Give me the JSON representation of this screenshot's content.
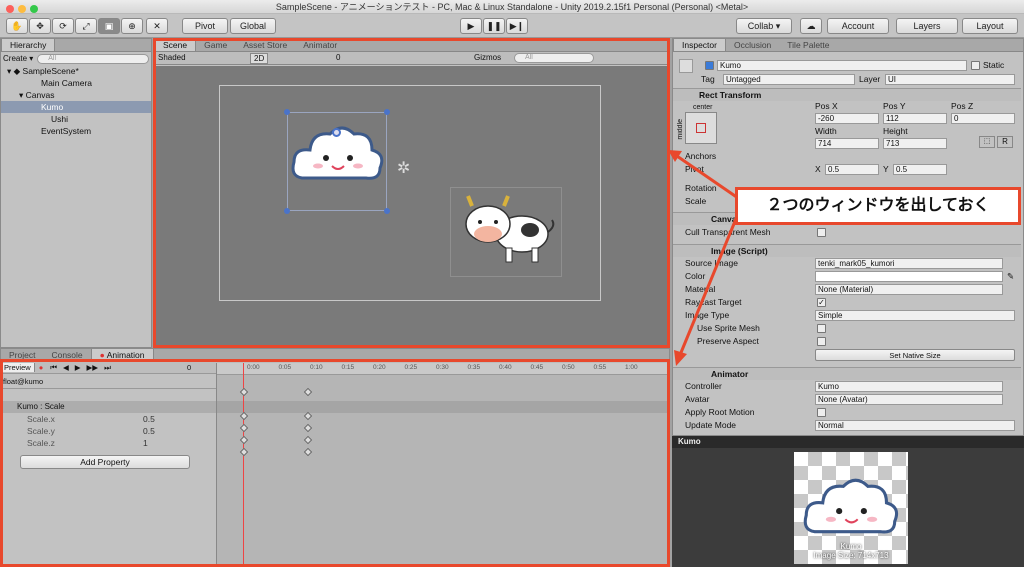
{
  "window": {
    "title": "SampleScene - アニメーションテスト - PC, Mac & Linux Standalone - Unity 2019.2.15f1 Personal (Personal) <Metal>"
  },
  "toolbar": {
    "pivot": "Pivot",
    "global": "Global",
    "collab": "Collab ▾",
    "account": "Account",
    "layers": "Layers",
    "layout": "Layout"
  },
  "hierarchy": {
    "tab": "Hierarchy",
    "create": "Create ▾",
    "search_placeholder": "All",
    "items": [
      "SampleScene*",
      "Main Camera",
      "Canvas",
      "Kumo",
      "Ushi",
      "EventSystem"
    ]
  },
  "scene": {
    "tabs": [
      "Scene",
      "Game",
      "Asset Store",
      "Animator"
    ],
    "shading": "Shaded",
    "mode2d": "2D",
    "gizmos": "Gizmos",
    "search_placeholder": "All",
    "layers_count": "0"
  },
  "bottom_tabs": [
    "Project",
    "Console",
    "Animation"
  ],
  "animation": {
    "preview": "Preview",
    "frame": "0",
    "clip": "float@kumo",
    "times": [
      "0:00",
      "0:05",
      "0:10",
      "0:15",
      "0:20",
      "0:25",
      "0:30",
      "0:35",
      "0:40",
      "0:45",
      "0:50",
      "0:55",
      "1:00"
    ],
    "property": "Kumo : Scale",
    "props": [
      {
        "name": "Scale.x",
        "value": "0.5"
      },
      {
        "name": "Scale.y",
        "value": "0.5"
      },
      {
        "name": "Scale.z",
        "value": "1"
      }
    ],
    "add_property": "Add Property"
  },
  "inspector": {
    "tabs": [
      "Inspector",
      "Occlusion",
      "Tile Palette"
    ],
    "name": "Kumo",
    "static": "Static",
    "tag_label": "Tag",
    "tag": "Untagged",
    "layer_label": "Layer",
    "layer": "UI",
    "rect_transform": "Rect Transform",
    "anchor_h": "center",
    "anchor_v": "middle",
    "posx_l": "Pos X",
    "posy_l": "Pos Y",
    "posz_l": "Pos Z",
    "posx": "-260",
    "posy": "112",
    "posz": "0",
    "width_l": "Width",
    "height_l": "Height",
    "width": "714",
    "height": "713",
    "r": "R",
    "anchors": "Anchors",
    "pivot": "Pivot",
    "pivot_x": "0.5",
    "pivot_y": "0.5",
    "x_l": "X",
    "y_l": "Y",
    "rotation": "Rotation",
    "scale": "Scale",
    "canvas_renderer": "Canvas Renderer",
    "cull": "Cull Transparent Mesh",
    "image": "Image (Script)",
    "source_image_l": "Source Image",
    "source_image": "tenki_mark05_kumori",
    "color_l": "Color",
    "material_l": "Material",
    "material": "None (Material)",
    "raycast": "Raycast Target",
    "image_type_l": "Image Type",
    "image_type": "Simple",
    "use_sprite_mesh": "Use Sprite Mesh",
    "preserve": "Preserve Aspect",
    "native_size": "Set Native Size",
    "animator": "Animator",
    "controller_l": "Controller",
    "controller": "Kumo",
    "avatar_l": "Avatar",
    "avatar": "None (Avatar)",
    "root_motion": "Apply Root Motion",
    "update_mode_l": "Update Mode",
    "update_mode": "Normal"
  },
  "preview": {
    "title": "Kumo",
    "caption": "Kumo",
    "size": "Image Size: 714x713"
  },
  "callout": {
    "text": "２つのウィンドウを出しておく"
  },
  "colors": {
    "accent": "#e8482c"
  }
}
